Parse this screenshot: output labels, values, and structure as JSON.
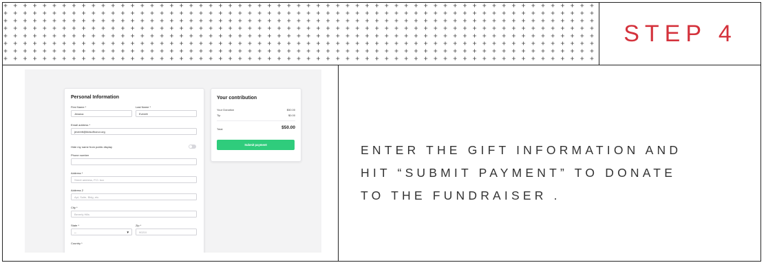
{
  "step": {
    "label": "STEP 4",
    "color": "#d4323c"
  },
  "description": {
    "lines": [
      "ENTER THE GIFT INFORMATION AND",
      "HIT “SUBMIT PAYMENT” TO DONATE",
      "TO THE FUNDRAISER ."
    ]
  },
  "form": {
    "title": "Personal Information",
    "first_name": {
      "label": "First Name *",
      "value": "Jessica"
    },
    "last_name": {
      "label": "Last Name *",
      "value": "Everett"
    },
    "email": {
      "label": "Email address *",
      "value": "jeverett@bidsofhonor.org"
    },
    "hide_name": {
      "label": "Hide my name from public display"
    },
    "phone": {
      "label": "Phone number",
      "value": ""
    },
    "address": {
      "label": "Address *",
      "placeholder": "Street address, P.O. box"
    },
    "address2": {
      "label": "Address 2",
      "placeholder": "Apt, Suite, Bldg, etc."
    },
    "city": {
      "label": "City *",
      "placeholder": "Beverly Hills"
    },
    "state": {
      "label": "State *",
      "value": "--"
    },
    "zip": {
      "label": "Zip *",
      "placeholder": "90210"
    },
    "country": {
      "label": "Country *"
    }
  },
  "contribution": {
    "title": "Your contribution",
    "donation_label": "Your Donation",
    "donation_value": "$50.00",
    "tip_label": "Tip",
    "tip_value": "$0.00",
    "total_label": "Total",
    "total_value": "$50.00",
    "submit_label": "Submit payment",
    "button_color": "#2fcc7c"
  }
}
